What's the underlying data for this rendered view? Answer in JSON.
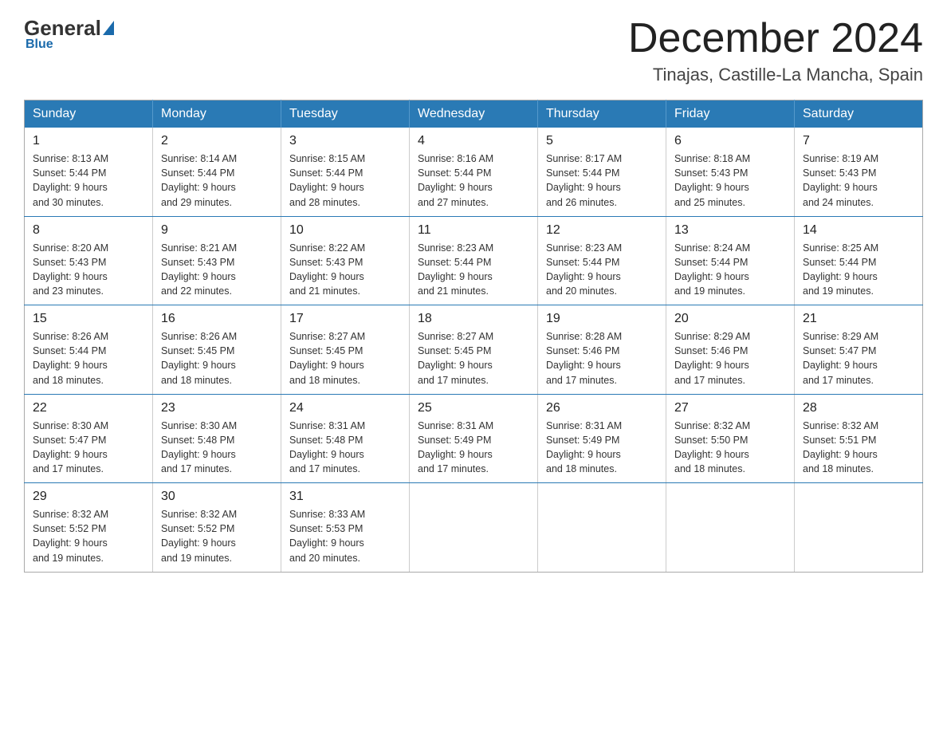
{
  "header": {
    "logo": {
      "general": "General",
      "blue": "Blue",
      "underline": "Blue"
    },
    "title": "December 2024",
    "location": "Tinajas, Castille-La Mancha, Spain"
  },
  "calendar": {
    "days_of_week": [
      "Sunday",
      "Monday",
      "Tuesday",
      "Wednesday",
      "Thursday",
      "Friday",
      "Saturday"
    ],
    "weeks": [
      [
        {
          "day": "1",
          "sunrise": "Sunrise: 8:13 AM",
          "sunset": "Sunset: 5:44 PM",
          "daylight": "Daylight: 9 hours and 30 minutes."
        },
        {
          "day": "2",
          "sunrise": "Sunrise: 8:14 AM",
          "sunset": "Sunset: 5:44 PM",
          "daylight": "Daylight: 9 hours and 29 minutes."
        },
        {
          "day": "3",
          "sunrise": "Sunrise: 8:15 AM",
          "sunset": "Sunset: 5:44 PM",
          "daylight": "Daylight: 9 hours and 28 minutes."
        },
        {
          "day": "4",
          "sunrise": "Sunrise: 8:16 AM",
          "sunset": "Sunset: 5:44 PM",
          "daylight": "Daylight: 9 hours and 27 minutes."
        },
        {
          "day": "5",
          "sunrise": "Sunrise: 8:17 AM",
          "sunset": "Sunset: 5:44 PM",
          "daylight": "Daylight: 9 hours and 26 minutes."
        },
        {
          "day": "6",
          "sunrise": "Sunrise: 8:18 AM",
          "sunset": "Sunset: 5:43 PM",
          "daylight": "Daylight: 9 hours and 25 minutes."
        },
        {
          "day": "7",
          "sunrise": "Sunrise: 8:19 AM",
          "sunset": "Sunset: 5:43 PM",
          "daylight": "Daylight: 9 hours and 24 minutes."
        }
      ],
      [
        {
          "day": "8",
          "sunrise": "Sunrise: 8:20 AM",
          "sunset": "Sunset: 5:43 PM",
          "daylight": "Daylight: 9 hours and 23 minutes."
        },
        {
          "day": "9",
          "sunrise": "Sunrise: 8:21 AM",
          "sunset": "Sunset: 5:43 PM",
          "daylight": "Daylight: 9 hours and 22 minutes."
        },
        {
          "day": "10",
          "sunrise": "Sunrise: 8:22 AM",
          "sunset": "Sunset: 5:43 PM",
          "daylight": "Daylight: 9 hours and 21 minutes."
        },
        {
          "day": "11",
          "sunrise": "Sunrise: 8:23 AM",
          "sunset": "Sunset: 5:44 PM",
          "daylight": "Daylight: 9 hours and 21 minutes."
        },
        {
          "day": "12",
          "sunrise": "Sunrise: 8:23 AM",
          "sunset": "Sunset: 5:44 PM",
          "daylight": "Daylight: 9 hours and 20 minutes."
        },
        {
          "day": "13",
          "sunrise": "Sunrise: 8:24 AM",
          "sunset": "Sunset: 5:44 PM",
          "daylight": "Daylight: 9 hours and 19 minutes."
        },
        {
          "day": "14",
          "sunrise": "Sunrise: 8:25 AM",
          "sunset": "Sunset: 5:44 PM",
          "daylight": "Daylight: 9 hours and 19 minutes."
        }
      ],
      [
        {
          "day": "15",
          "sunrise": "Sunrise: 8:26 AM",
          "sunset": "Sunset: 5:44 PM",
          "daylight": "Daylight: 9 hours and 18 minutes."
        },
        {
          "day": "16",
          "sunrise": "Sunrise: 8:26 AM",
          "sunset": "Sunset: 5:45 PM",
          "daylight": "Daylight: 9 hours and 18 minutes."
        },
        {
          "day": "17",
          "sunrise": "Sunrise: 8:27 AM",
          "sunset": "Sunset: 5:45 PM",
          "daylight": "Daylight: 9 hours and 18 minutes."
        },
        {
          "day": "18",
          "sunrise": "Sunrise: 8:27 AM",
          "sunset": "Sunset: 5:45 PM",
          "daylight": "Daylight: 9 hours and 17 minutes."
        },
        {
          "day": "19",
          "sunrise": "Sunrise: 8:28 AM",
          "sunset": "Sunset: 5:46 PM",
          "daylight": "Daylight: 9 hours and 17 minutes."
        },
        {
          "day": "20",
          "sunrise": "Sunrise: 8:29 AM",
          "sunset": "Sunset: 5:46 PM",
          "daylight": "Daylight: 9 hours and 17 minutes."
        },
        {
          "day": "21",
          "sunrise": "Sunrise: 8:29 AM",
          "sunset": "Sunset: 5:47 PM",
          "daylight": "Daylight: 9 hours and 17 minutes."
        }
      ],
      [
        {
          "day": "22",
          "sunrise": "Sunrise: 8:30 AM",
          "sunset": "Sunset: 5:47 PM",
          "daylight": "Daylight: 9 hours and 17 minutes."
        },
        {
          "day": "23",
          "sunrise": "Sunrise: 8:30 AM",
          "sunset": "Sunset: 5:48 PM",
          "daylight": "Daylight: 9 hours and 17 minutes."
        },
        {
          "day": "24",
          "sunrise": "Sunrise: 8:31 AM",
          "sunset": "Sunset: 5:48 PM",
          "daylight": "Daylight: 9 hours and 17 minutes."
        },
        {
          "day": "25",
          "sunrise": "Sunrise: 8:31 AM",
          "sunset": "Sunset: 5:49 PM",
          "daylight": "Daylight: 9 hours and 17 minutes."
        },
        {
          "day": "26",
          "sunrise": "Sunrise: 8:31 AM",
          "sunset": "Sunset: 5:49 PM",
          "daylight": "Daylight: 9 hours and 18 minutes."
        },
        {
          "day": "27",
          "sunrise": "Sunrise: 8:32 AM",
          "sunset": "Sunset: 5:50 PM",
          "daylight": "Daylight: 9 hours and 18 minutes."
        },
        {
          "day": "28",
          "sunrise": "Sunrise: 8:32 AM",
          "sunset": "Sunset: 5:51 PM",
          "daylight": "Daylight: 9 hours and 18 minutes."
        }
      ],
      [
        {
          "day": "29",
          "sunrise": "Sunrise: 8:32 AM",
          "sunset": "Sunset: 5:52 PM",
          "daylight": "Daylight: 9 hours and 19 minutes."
        },
        {
          "day": "30",
          "sunrise": "Sunrise: 8:32 AM",
          "sunset": "Sunset: 5:52 PM",
          "daylight": "Daylight: 9 hours and 19 minutes."
        },
        {
          "day": "31",
          "sunrise": "Sunrise: 8:33 AM",
          "sunset": "Sunset: 5:53 PM",
          "daylight": "Daylight: 9 hours and 20 minutes."
        },
        null,
        null,
        null,
        null
      ]
    ]
  }
}
